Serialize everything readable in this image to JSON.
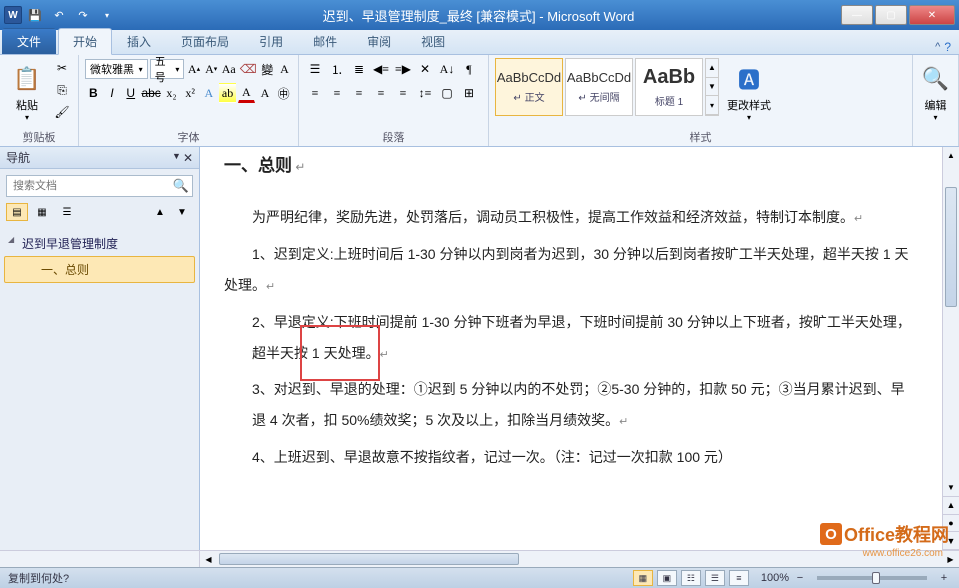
{
  "titlebar": {
    "title": "迟到、早退管理制度_最终 [兼容模式] - Microsoft Word",
    "app_letter": "W"
  },
  "tabs": {
    "file": "文件",
    "items": [
      "开始",
      "插入",
      "页面布局",
      "引用",
      "邮件",
      "审阅",
      "视图"
    ]
  },
  "ribbon": {
    "clipboard": {
      "label": "剪贴板",
      "paste": "粘贴"
    },
    "font": {
      "label": "字体",
      "name": "微软雅黑",
      "size": "五号"
    },
    "paragraph": {
      "label": "段落"
    },
    "styles": {
      "label": "样式",
      "change": "更改样式",
      "items": [
        {
          "preview": "AaBbCcDd",
          "name": "↵ 正文"
        },
        {
          "preview": "AaBbCcDd",
          "name": "↵ 无间隔"
        },
        {
          "preview": "AaBb",
          "name": "标题 1"
        }
      ]
    },
    "editing": {
      "label": "编辑"
    }
  },
  "nav": {
    "title": "导航",
    "search_placeholder": "搜索文档",
    "items": [
      {
        "text": "迟到早退管理制度",
        "level": 1
      },
      {
        "text": "一、总则",
        "level": 2
      }
    ]
  },
  "document": {
    "heading": "一、总则",
    "p1": "为严明纪律，奖励先进，处罚落后，调动员工积极性，提高工作效益和经济效益，特制订本制度。",
    "p2": "1、迟到定义:上班时间后 1-30 分钟以内到岗者为迟到，30 分钟以后到岗者按旷工半天处理，超半天按 1 天处理。",
    "p3": "2、早退定义:下班时间提前 1-30 分钟下班者为早退，下班时间提前 30 分钟以上下班者，按旷工半天处理，超半天按 1 天处理。",
    "p4": "3、对迟到、早退的处理：①迟到 5 分钟以内的不处罚；②5-30 分钟的，扣款 50 元；③当月累计迟到、早退 4 次者，扣 50%绩效奖；5 次及以上，扣除当月绩效奖。",
    "p5": "4、上班迟到、早退故意不按指纹者，记过一次。（注：记过一次扣款 100 元）"
  },
  "statusbar": {
    "left": "复制到何处?",
    "zoom": "100%"
  },
  "watermark": {
    "text": "Office教程网",
    "url": "www.office26.com"
  }
}
